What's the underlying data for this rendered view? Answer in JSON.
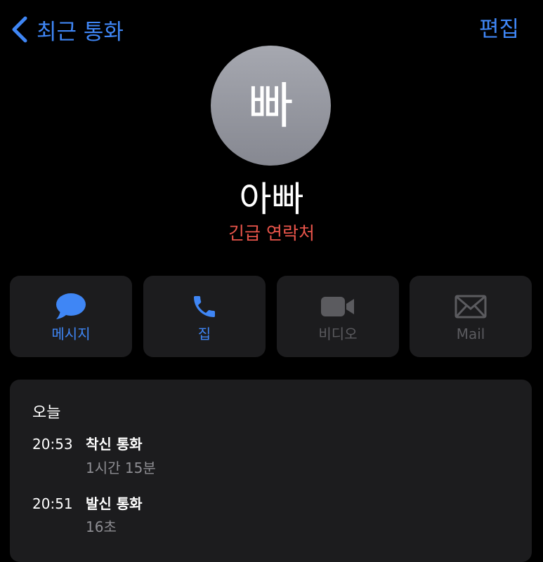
{
  "nav": {
    "back_label": "최근 통화",
    "edit_label": "편집"
  },
  "contact": {
    "avatar_initial": "빠",
    "name": "아빠",
    "subtitle": "긴급 연락처"
  },
  "actions": [
    {
      "label": "메시지",
      "icon": "message-bubble-icon",
      "enabled": true
    },
    {
      "label": "집",
      "icon": "phone-icon",
      "enabled": true
    },
    {
      "label": "비디오",
      "icon": "video-camera-icon",
      "enabled": false
    },
    {
      "label": "Mail",
      "icon": "envelope-icon",
      "enabled": false
    }
  ],
  "history": {
    "date": "오늘",
    "calls": [
      {
        "time": "20:53",
        "type": "착신 통화",
        "duration": "1시간 15분"
      },
      {
        "time": "20:51",
        "type": "발신 통화",
        "duration": "16초"
      }
    ]
  },
  "colors": {
    "accent": "#3f86f5",
    "emergency": "#e8544a",
    "card_background": "#1c1c1e",
    "disabled": "#5b5b5f",
    "secondary_text": "#8e8e93"
  }
}
